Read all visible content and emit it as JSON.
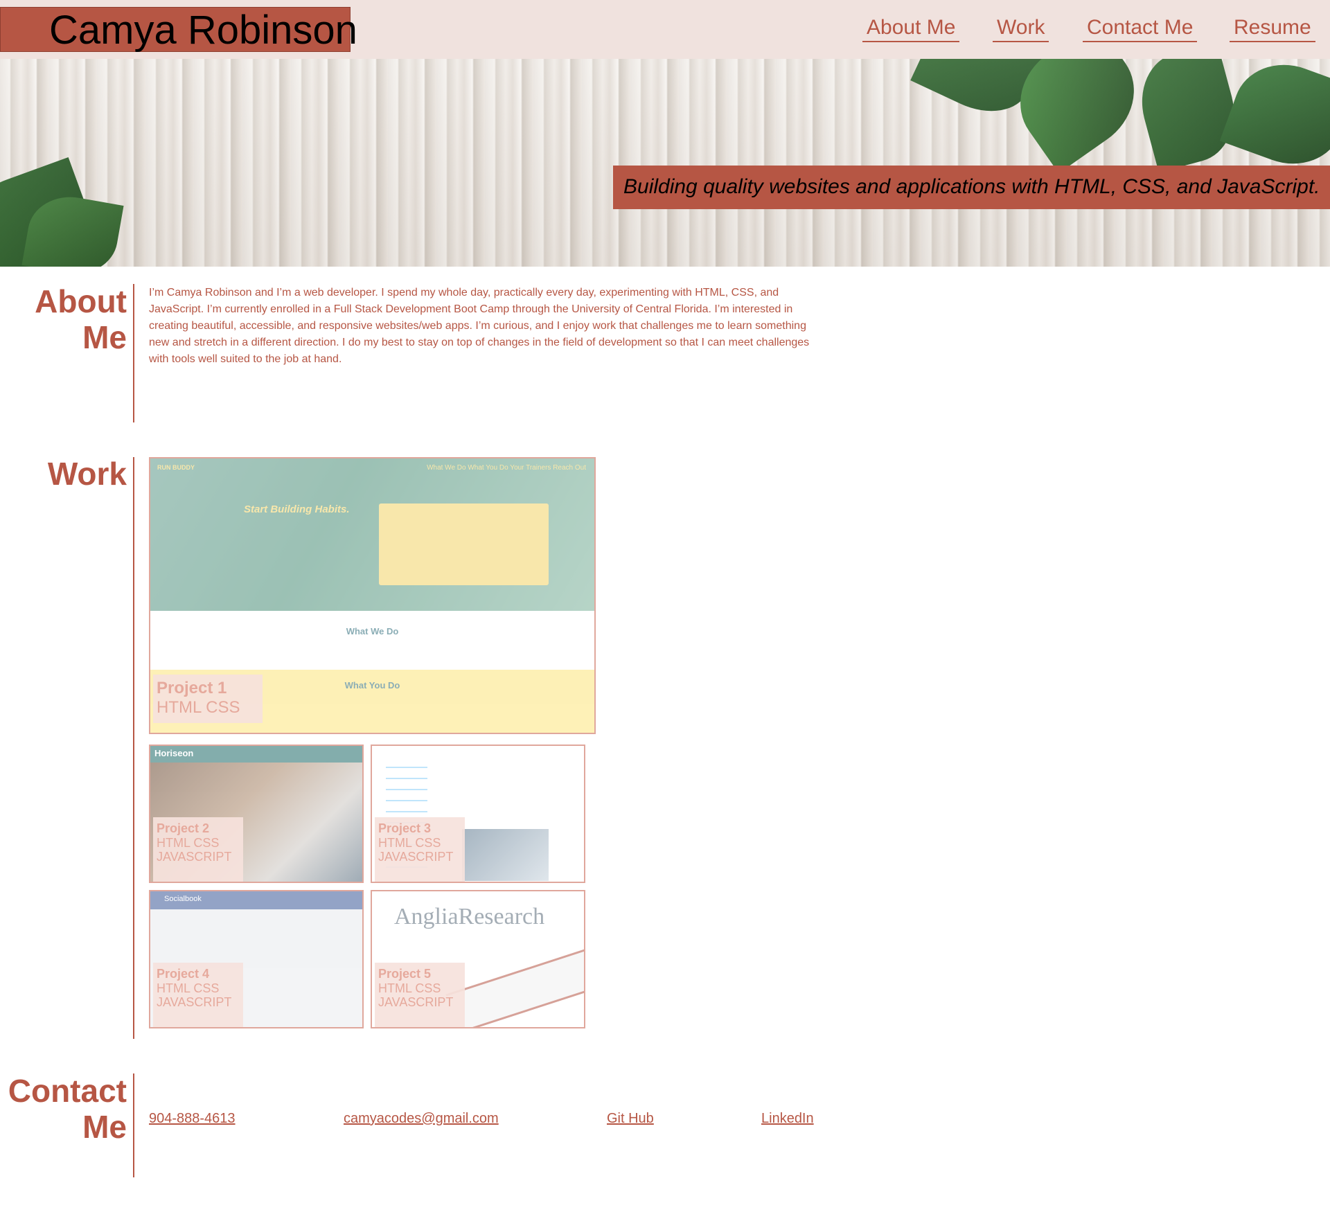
{
  "header": {
    "name": "Camya Robinson",
    "nav": [
      "About Me",
      "Work",
      "Contact Me",
      "Resume"
    ]
  },
  "hero": {
    "tagline": "Building quality websites and applications with HTML, CSS, and JavaScript."
  },
  "about": {
    "title_line1": "About",
    "title_line2": "Me",
    "text": "I’m Camya Robinson and I’m a web developer. I spend my whole day, practically every day, experimenting with HTML, CSS, and JavaScript. I’m currently enrolled in a Full Stack Development Boot Camp through the University of Central Florida. I’m interested in creating beautiful, accessible, and responsive websites/web apps. I’m curious, and I enjoy work that challenges me to learn something new and stretch in a different direction. I do my best to stay on top of changes in the field of development so that I can meet challenges with tools well suited to the job at hand."
  },
  "work": {
    "title": "Work",
    "projects": [
      {
        "name": "Project 1",
        "tech": "HTML CSS",
        "tech2": ""
      },
      {
        "name": "Project 2",
        "tech": "HTML CSS",
        "tech2": "JAVASCRIPT"
      },
      {
        "name": "Project 3",
        "tech": "HTML CSS",
        "tech2": "JAVASCRIPT"
      },
      {
        "name": "Project 4",
        "tech": "HTML CSS",
        "tech2": "JAVASCRIPT"
      },
      {
        "name": "Project 5",
        "tech": "HTML CSS",
        "tech2": "JAVASCRIPT"
      }
    ],
    "mock": {
      "run_buddy": "RUN BUDDY",
      "run_buddy_nav": "What We Do   What You Do   Your Trainers   Reach Out",
      "run_buddy_headline": "Start Building Habits.",
      "what_we_do": "What We Do",
      "what_you_do": "What You Do",
      "horiseon": "Horiseon",
      "socialbook": "Socialbook",
      "anglia": "AngliaResearch"
    }
  },
  "contact": {
    "title_line1": "Contact",
    "title_line2": "Me",
    "phone": "904-888-4613",
    "email": "camyacodes@gmail.com",
    "github": "Git Hub",
    "linkedin": "LinkedIn"
  },
  "colors": {
    "accent": "#b65644",
    "header_bg": "#f0e2de",
    "caption_text": "#e6a99c"
  }
}
